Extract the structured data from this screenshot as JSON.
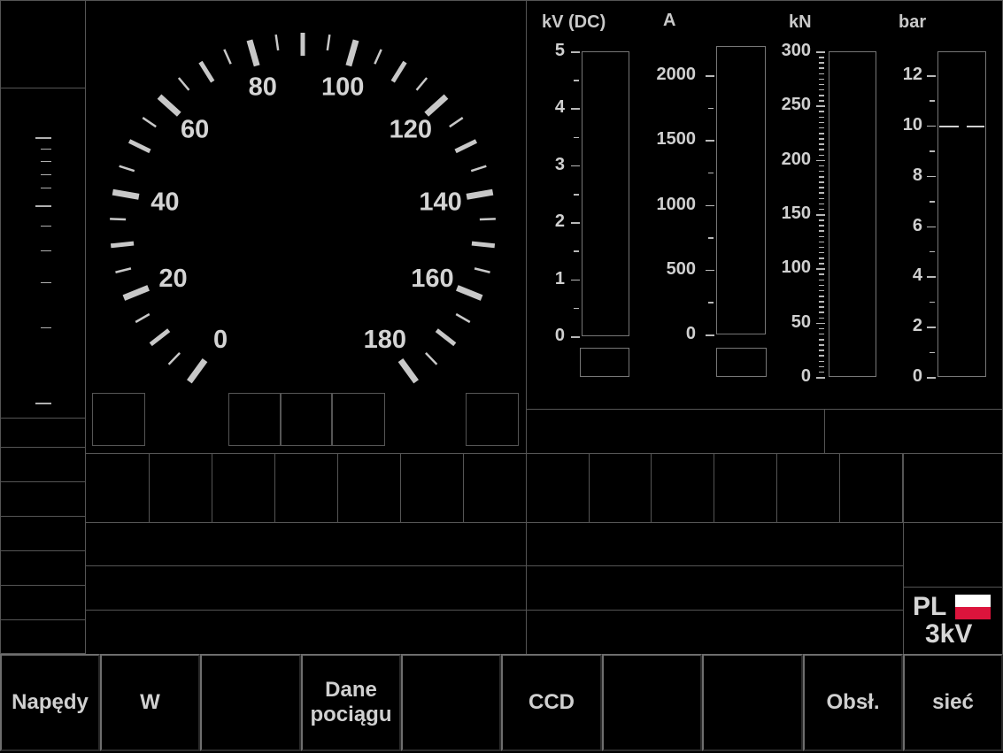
{
  "speedometer": {
    "labels": [
      "0",
      "20",
      "40",
      "60",
      "80",
      "100",
      "120",
      "140",
      "160",
      "180"
    ],
    "min": 0,
    "max": 180
  },
  "gauges": [
    {
      "unit": "kV (DC)",
      "ticks": [
        "5",
        "4",
        "3",
        "2",
        "1",
        "0"
      ]
    },
    {
      "unit": "A",
      "ticks": [
        "2000",
        "1500",
        "1000",
        "500",
        "0"
      ]
    },
    {
      "unit": "kN",
      "ticks": [
        "300",
        "250",
        "200",
        "150",
        "100",
        "50",
        "0"
      ]
    },
    {
      "unit": "bar",
      "ticks": [
        "12",
        "10",
        "8",
        "6",
        "4",
        "2",
        "0"
      ]
    }
  ],
  "brake_pressure_marker": 10,
  "network": {
    "country": "PL",
    "voltage": "3kV",
    "flag_colors": [
      "#ffffff",
      "#dc143c"
    ]
  },
  "softkeys": [
    "Napędy",
    "W",
    "",
    "Dane\npociągu",
    "",
    "CCD",
    "",
    "",
    "Obsł.",
    "sieć"
  ]
}
